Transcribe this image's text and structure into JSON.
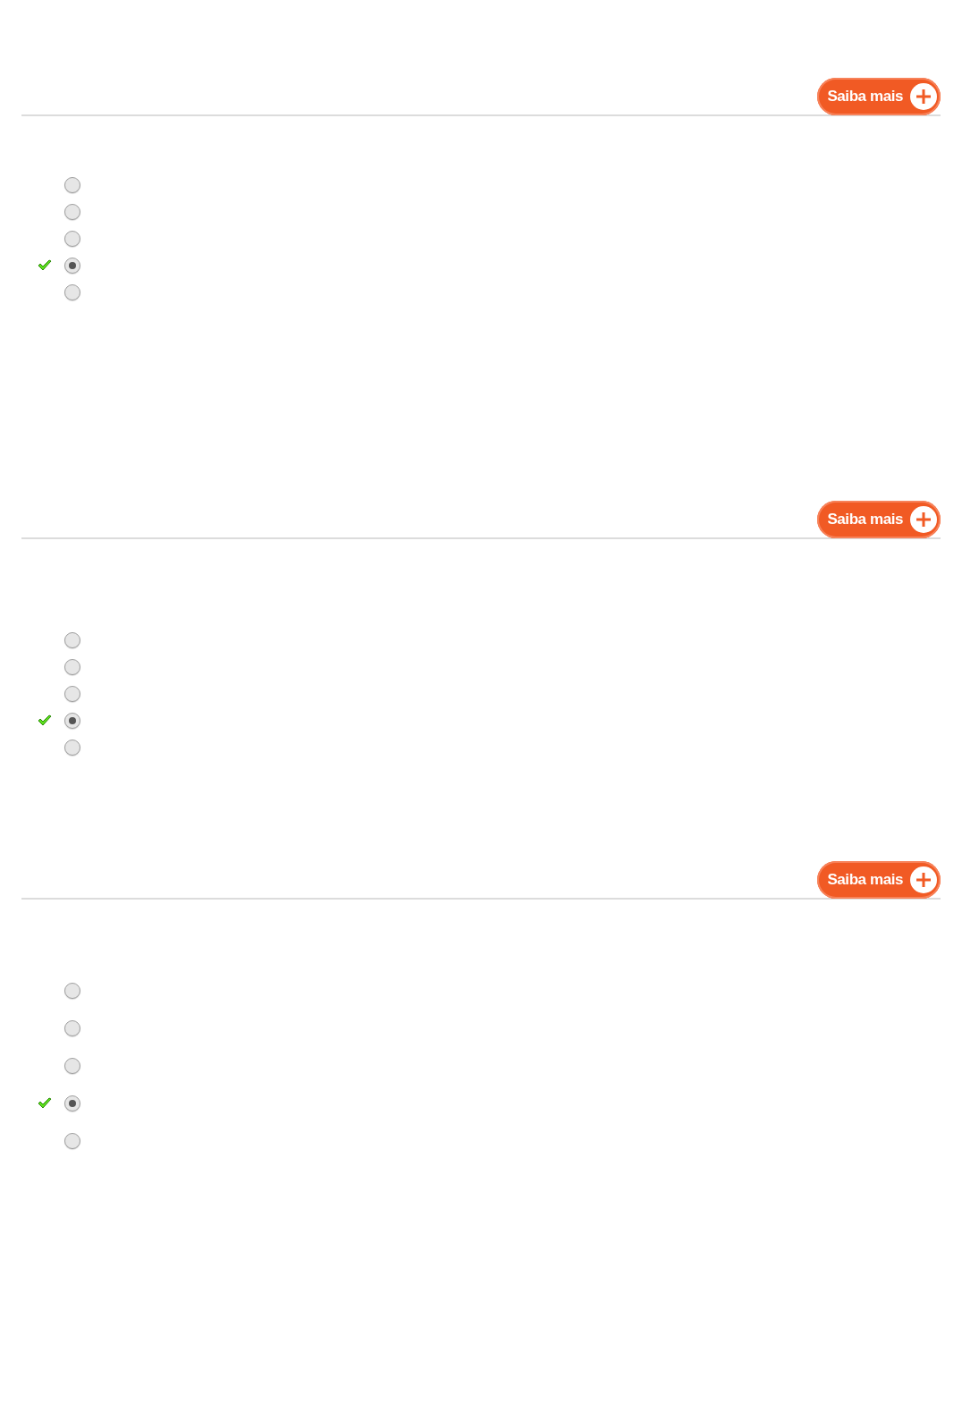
{
  "questions": [
    {
      "button": "Saiba mais",
      "options": [
        {
          "selected": false,
          "correct": false
        },
        {
          "selected": false,
          "correct": false
        },
        {
          "selected": false,
          "correct": false
        },
        {
          "selected": true,
          "correct": true
        },
        {
          "selected": false,
          "correct": false
        }
      ]
    },
    {
      "button": "Saiba mais",
      "options": [
        {
          "selected": false,
          "correct": false
        },
        {
          "selected": false,
          "correct": false
        },
        {
          "selected": false,
          "correct": false
        },
        {
          "selected": true,
          "correct": true
        },
        {
          "selected": false,
          "correct": false
        }
      ]
    },
    {
      "button": "Saiba mais",
      "options": [
        {
          "selected": false,
          "correct": false
        },
        {
          "selected": false,
          "correct": false
        },
        {
          "selected": false,
          "correct": false
        },
        {
          "selected": true,
          "correct": true
        },
        {
          "selected": false,
          "correct": false
        }
      ]
    }
  ]
}
